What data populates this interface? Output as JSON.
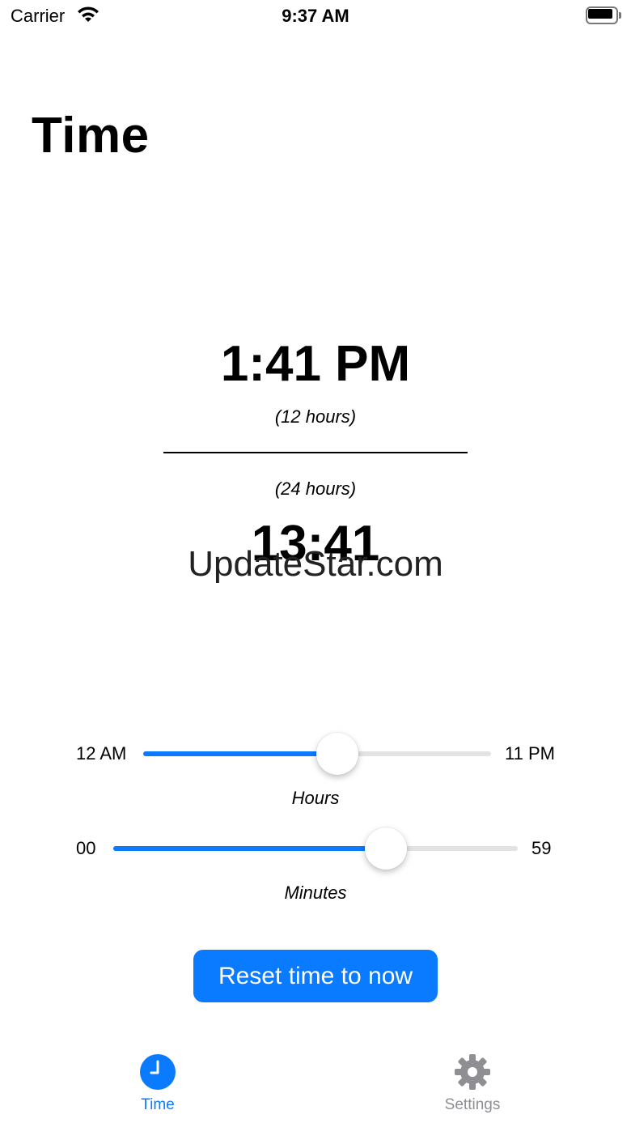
{
  "status_bar": {
    "carrier": "Carrier",
    "time": "9:37 AM"
  },
  "page": {
    "title": "Time"
  },
  "display": {
    "time_12h": "1:41 PM",
    "caption_12h": "(12 hours)",
    "caption_24h": "(24 hours)",
    "time_24h": "13:41"
  },
  "watermark": "UpdateStar.com",
  "sliders": {
    "hours": {
      "min_label": "12 AM",
      "max_label": "11 PM",
      "caption": "Hours",
      "value": 13,
      "min": 0,
      "max": 23
    },
    "minutes": {
      "min_label": "00",
      "max_label": "59",
      "caption": "Minutes",
      "value": 41,
      "min": 0,
      "max": 59
    }
  },
  "reset_button": {
    "label": "Reset time to now"
  },
  "tab_bar": {
    "items": [
      {
        "label": "Time",
        "icon": "clock-icon",
        "selected": true
      },
      {
        "label": "Settings",
        "icon": "gear-icon",
        "selected": false
      }
    ]
  },
  "colors": {
    "accent": "#0a7aff",
    "inactive_tab": "#8e8e93",
    "track": "#e3e3e6"
  }
}
